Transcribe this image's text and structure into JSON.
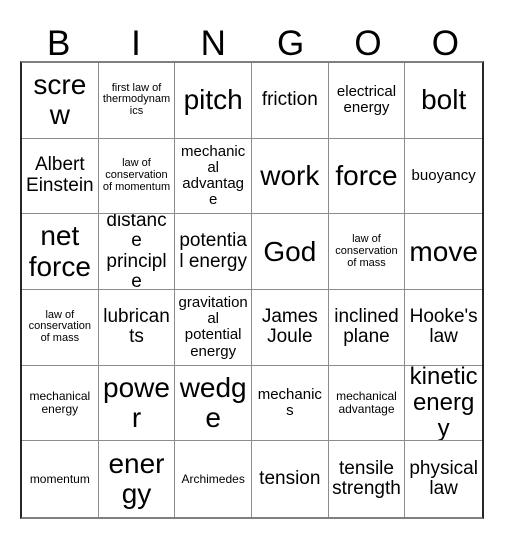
{
  "card": {
    "header_letters": [
      "B",
      "I",
      "N",
      "G",
      "O",
      "O"
    ],
    "columns": 6,
    "rows": 6,
    "rows_data": [
      [
        {
          "text": "screw",
          "size": "xl"
        },
        {
          "text": "first law of thermodynamics",
          "size": "xxs"
        },
        {
          "text": "pitch",
          "size": "xl"
        },
        {
          "text": "friction",
          "size": "md"
        },
        {
          "text": "electrical energy",
          "size": "sm"
        },
        {
          "text": "bolt",
          "size": "xl"
        }
      ],
      [
        {
          "text": "Albert Einstein",
          "size": "md"
        },
        {
          "text": "law of conservation of momentum",
          "size": "xxs"
        },
        {
          "text": "mechanical advantage",
          "size": "sm"
        },
        {
          "text": "work",
          "size": "xl"
        },
        {
          "text": "force",
          "size": "xl"
        },
        {
          "text": "buoyancy",
          "size": "sm"
        }
      ],
      [
        {
          "text": "net force",
          "size": "xl"
        },
        {
          "text": "distance principle",
          "size": "md"
        },
        {
          "text": "potential energy",
          "size": "md"
        },
        {
          "text": "God",
          "size": "xl"
        },
        {
          "text": "law of conservation of mass",
          "size": "xxs"
        },
        {
          "text": "move",
          "size": "xl"
        }
      ],
      [
        {
          "text": "law of conservation of mass",
          "size": "xxs"
        },
        {
          "text": "lubricants",
          "size": "md"
        },
        {
          "text": "gravitational potential energy",
          "size": "sm"
        },
        {
          "text": "James Joule",
          "size": "md"
        },
        {
          "text": "inclined plane",
          "size": "md"
        },
        {
          "text": "Hooke's law",
          "size": "md"
        }
      ],
      [
        {
          "text": "mechanical energy",
          "size": "xs"
        },
        {
          "text": "power",
          "size": "xl"
        },
        {
          "text": "wedge",
          "size": "xl"
        },
        {
          "text": "mechanics",
          "size": "sm"
        },
        {
          "text": "mechanical advantage",
          "size": "xs"
        },
        {
          "text": "kinetic energy",
          "size": "lg"
        }
      ],
      [
        {
          "text": "momentum",
          "size": "xs"
        },
        {
          "text": "energy",
          "size": "xl"
        },
        {
          "text": "Archimedes",
          "size": "xs"
        },
        {
          "text": "tension",
          "size": "md"
        },
        {
          "text": "tensile strength",
          "size": "md"
        },
        {
          "text": "physical law",
          "size": "md"
        }
      ]
    ]
  },
  "colors": {
    "background": "#ffffff",
    "text": "#000000",
    "grid_line": "#8c8c8c",
    "grid_border_dark": "#262626",
    "grid_border_light": "#808080"
  }
}
